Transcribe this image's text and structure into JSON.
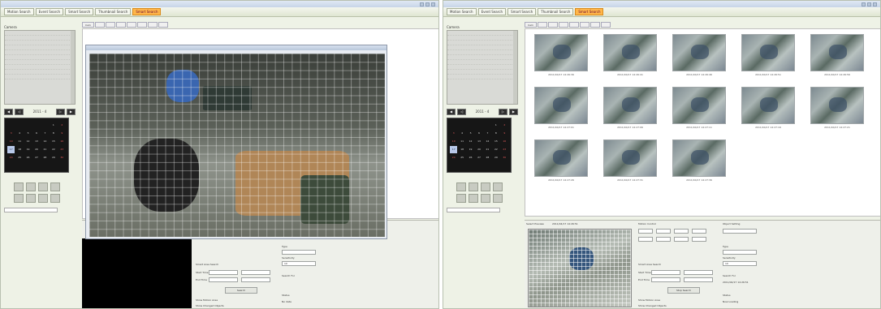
{
  "left_window": {
    "title": "",
    "toolbar": [
      "Motion Search",
      "Event Search",
      "Smart Search",
      "Thumbnail Search",
      "Smart Search"
    ],
    "active_tool_index": 4,
    "tree_label": "Camera",
    "month_label": "2011 - 4",
    "tabs": [
      "Cam",
      "",
      "",
      "",
      "",
      "",
      "",
      ""
    ],
    "video_title": "",
    "form": {
      "search_area_label": "Smart Area Search",
      "start_time_label": "Start Time",
      "end_time_label": "End Time",
      "search_button": "Search",
      "type_label": "Type",
      "sensitivity_label": "Sensitivity",
      "sensitivity_value": "10",
      "search_for_label": "Search For",
      "status_label": "Status",
      "status_value": "No data",
      "opt1": "Show Motion Area",
      "opt2": "Show Changed Objects"
    }
  },
  "right_window": {
    "title": "",
    "toolbar": [
      "Motion Search",
      "Event Search",
      "Smart Search",
      "Thumbnail Search",
      "Smart Search"
    ],
    "active_tool_index": 4,
    "tree_label": "Camera",
    "month_label": "2011 - 4",
    "tabs": [
      "Cam",
      "",
      "",
      "",
      "",
      "",
      "",
      ""
    ],
    "thumb_captions": [
      "2011/04/17 14:26:36",
      "2011/04/17 14:26:41",
      "2011/04/17 14:26:46",
      "2011/04/17 14:26:51",
      "2011/04/17 14:26:56",
      "2011/04/17 14:27:01",
      "2011/04/17 14:27:06",
      "2011/04/17 14:27:11",
      "2011/04/17 14:27:16",
      "2011/04/17 14:27:21",
      "2011/04/17 14:27:26",
      "2011/04/17 14:27:31",
      "2011/04/17 14:27:36"
    ],
    "preview_label": "Select Preview",
    "preview_time": "2011/04/17 14:26:51",
    "form": {
      "motion_control_label": "Motion Control",
      "object_setting_label": "Object Setting",
      "search_area_label": "Smart Area Search",
      "start_time_label": "Start Time",
      "end_time_label": "End Time",
      "search_button": "Stop Search",
      "type_label": "Type",
      "sensitivity_label": "Sensitivity",
      "sensitivity_value": "10",
      "search_for_label": "Search For",
      "search_for_value": "2011/04/17 14:26:51",
      "status_label": "Status",
      "status_value": "Now Loading",
      "opt1": "Show Motion Area",
      "opt2": "Show Changed Objects"
    }
  },
  "calendar_days": [
    "",
    "",
    "",
    "",
    "",
    "1",
    "2",
    "3",
    "4",
    "5",
    "6",
    "7",
    "8",
    "9",
    "10",
    "11",
    "12",
    "13",
    "14",
    "15",
    "16",
    "17",
    "18",
    "19",
    "20",
    "21",
    "22",
    "23",
    "24",
    "25",
    "26",
    "27",
    "28",
    "29",
    "30"
  ],
  "selected_day": "17"
}
